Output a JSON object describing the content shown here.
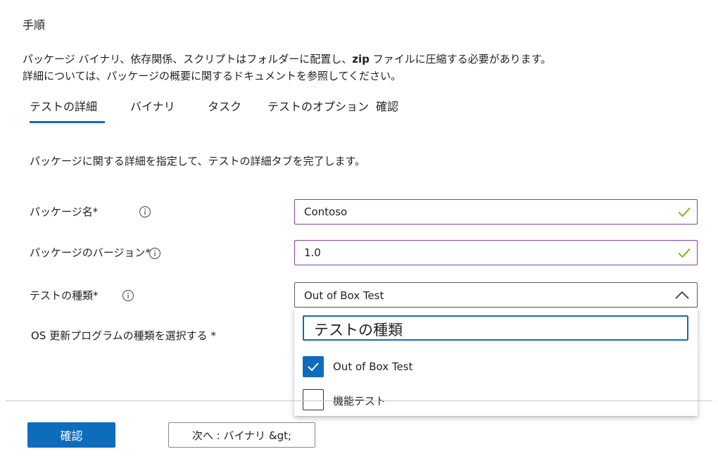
{
  "page": {
    "heading": "手順",
    "intro_line1_a": "パッケージ バイナリ、依存関係、スクリプトはフォルダーに配置し、",
    "intro_line1_b": "zip",
    "intro_line1_c": " ファイルに圧縮する必要があります。",
    "intro_line2": "詳細については、パッケージの概要に関するドキュメントを参照してください。"
  },
  "tabs": [
    {
      "label": "テストの詳細",
      "selected": true
    },
    {
      "label": "バイナリ",
      "selected": false
    },
    {
      "label": "タスク",
      "selected": false
    },
    {
      "label": "テストのオプション",
      "selected": false
    },
    {
      "label": "確認",
      "selected": false
    }
  ],
  "form": {
    "description": "パッケージに関する詳細を指定して、テストの詳細タブを完了します。",
    "package_name": {
      "label": "パッケージ名*",
      "value": "Contoso"
    },
    "package_version": {
      "label": "パッケージのバージョン*",
      "value": "1.0"
    },
    "test_type": {
      "label": "テストの種類*",
      "value": "Out of Box Test"
    },
    "os_update_type": {
      "label": "OS 更新プログラムの種類を選択する *"
    }
  },
  "dropdown": {
    "search_text": "テストの種類",
    "options": [
      {
        "label": "Out of Box Test",
        "checked": true
      },
      {
        "label": "機能テスト",
        "checked": false
      }
    ]
  },
  "footer": {
    "confirm_label": "確認",
    "next_label": "次へ : バイナリ &gt;"
  },
  "colors": {
    "accent": "#0f6cbd",
    "valid_border": "#8a3fa0",
    "valid_check": "#6bb700"
  },
  "icons": {
    "info": "info-icon",
    "check": "checkmark-icon",
    "chevron": "chevron-up-icon"
  }
}
